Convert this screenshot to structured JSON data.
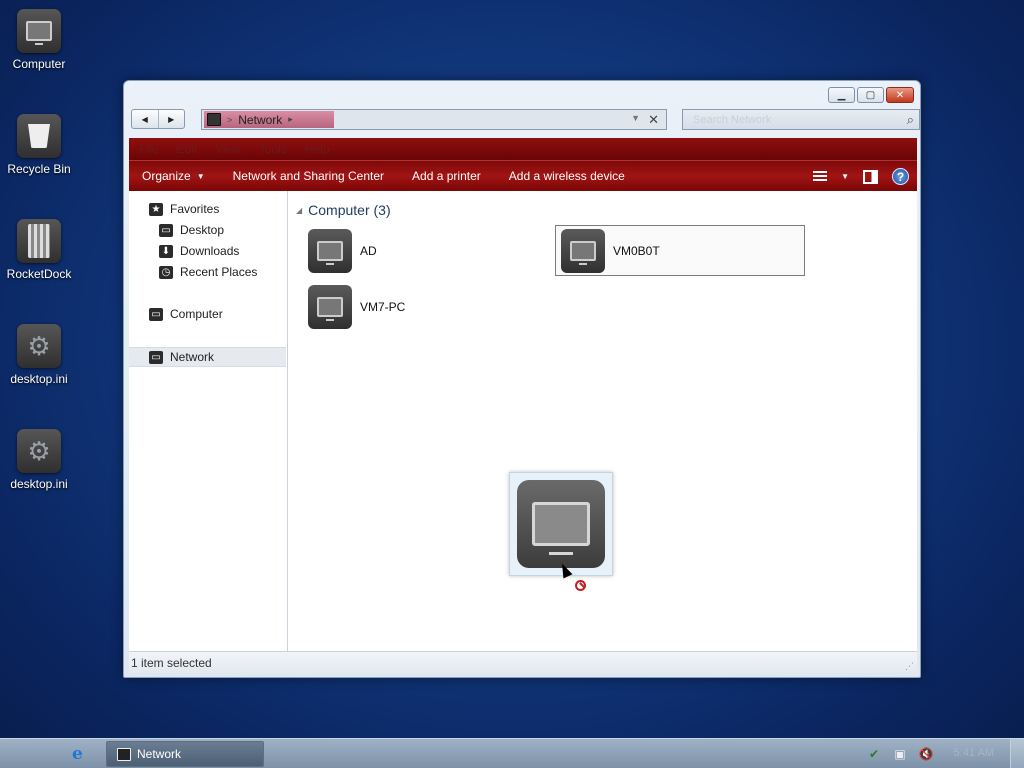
{
  "desktop": {
    "icons": [
      {
        "label": "Computer",
        "icon": "computer-icon"
      },
      {
        "label": "Recycle Bin",
        "icon": "recycle-bin-icon"
      },
      {
        "label": "RocketDock",
        "icon": "rocketdock-icon"
      },
      {
        "label": "desktop.ini",
        "icon": "settings-file-icon"
      },
      {
        "label": "desktop.ini",
        "icon": "settings-file-icon"
      }
    ]
  },
  "window": {
    "address": {
      "crumb": "Network"
    },
    "search": {
      "placeholder": "Search Network"
    },
    "menu": [
      "File",
      "Edit",
      "View",
      "Tools",
      "Help"
    ],
    "commands": {
      "organize": "Organize",
      "network_sharing": "Network and Sharing Center",
      "add_printer": "Add a printer",
      "add_wireless": "Add a wireless device"
    },
    "nav": {
      "favorites": "Favorites",
      "desktop": "Desktop",
      "downloads": "Downloads",
      "recent": "Recent Places",
      "computer": "Computer",
      "network": "Network"
    },
    "group_header": "Computer (3)",
    "items": [
      {
        "name": "AD"
      },
      {
        "name": "VM0B0T"
      },
      {
        "name": "VM7-PC"
      }
    ],
    "status": "1 item selected"
  },
  "taskbar": {
    "task": "Network",
    "clock": "5:41 AM"
  }
}
